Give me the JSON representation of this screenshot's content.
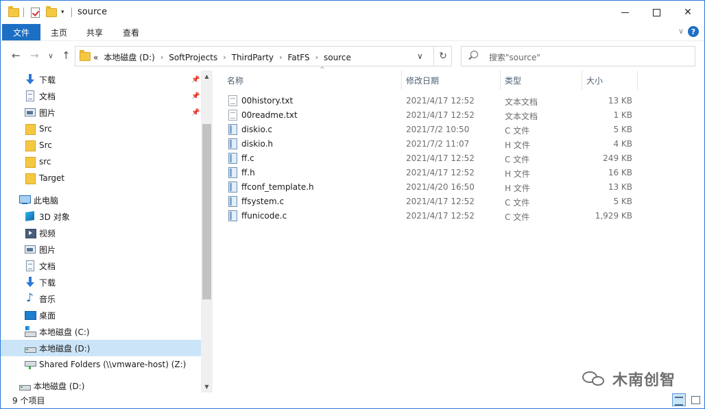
{
  "window": {
    "title": "source",
    "controls": {
      "minimize": "—",
      "maximize": "□",
      "close": "✕"
    }
  },
  "ribbon": {
    "tabs": [
      {
        "label": "文件",
        "active": true
      },
      {
        "label": "主页"
      },
      {
        "label": "共享"
      },
      {
        "label": "查看"
      }
    ],
    "collapse_glyph": "∨",
    "help_glyph": "?"
  },
  "nav": {
    "back": "←",
    "forward": "→",
    "recent": "∨",
    "up": "↑"
  },
  "address": {
    "overflow": "«",
    "crumbs": [
      "本地磁盘 (D:)",
      "SoftProjects",
      "ThirdParty",
      "FatFS",
      "source"
    ],
    "separator": "›",
    "dropdown": "∨",
    "refresh": "↻"
  },
  "search": {
    "placeholder": "搜索\"source\""
  },
  "sidebar": {
    "quick_access": [
      {
        "label": "下载",
        "icon": "download-icon",
        "pinned": true
      },
      {
        "label": "文档",
        "icon": "document-icon",
        "pinned": true
      },
      {
        "label": "图片",
        "icon": "picture-icon",
        "pinned": true
      },
      {
        "label": "Src",
        "icon": "folder-icon"
      },
      {
        "label": "Src",
        "icon": "folder-icon"
      },
      {
        "label": "src",
        "icon": "folder-icon"
      },
      {
        "label": "Target",
        "icon": "folder-icon"
      }
    ],
    "this_pc": {
      "label": "此电脑",
      "items": [
        {
          "label": "3D 对象",
          "icon": "3d-objects-icon"
        },
        {
          "label": "视频",
          "icon": "video-icon"
        },
        {
          "label": "图片",
          "icon": "picture-icon"
        },
        {
          "label": "文档",
          "icon": "document-icon"
        },
        {
          "label": "下载",
          "icon": "download-icon"
        },
        {
          "label": "音乐",
          "icon": "music-icon"
        },
        {
          "label": "桌面",
          "icon": "desktop-icon"
        },
        {
          "label": "本地磁盘 (C:)",
          "icon": "system-drive-icon"
        },
        {
          "label": "本地磁盘 (D:)",
          "icon": "drive-icon",
          "selected": true
        },
        {
          "label": "Shared Folders (\\\\vmware-host) (Z:)",
          "icon": "network-drive-icon"
        }
      ]
    },
    "bottom_item": {
      "label": "本地磁盘 (D:)",
      "icon": "drive-icon"
    },
    "pin_glyph": "📌"
  },
  "columns": {
    "name": "名称",
    "modified": "修改日期",
    "type": "类型",
    "size": "大小",
    "sort_glyph": "^"
  },
  "files": [
    {
      "name": "00history.txt",
      "modified": "2021/4/17 12:52",
      "type": "文本文档",
      "size": "13 KB",
      "kind": "txt"
    },
    {
      "name": "00readme.txt",
      "modified": "2021/4/17 12:52",
      "type": "文本文档",
      "size": "1 KB",
      "kind": "txt"
    },
    {
      "name": "diskio.c",
      "modified": "2021/7/2 10:50",
      "type": "C 文件",
      "size": "5 KB",
      "kind": "code"
    },
    {
      "name": "diskio.h",
      "modified": "2021/7/2 11:07",
      "type": "H 文件",
      "size": "4 KB",
      "kind": "code"
    },
    {
      "name": "ff.c",
      "modified": "2021/4/17 12:52",
      "type": "C 文件",
      "size": "249 KB",
      "kind": "code"
    },
    {
      "name": "ff.h",
      "modified": "2021/4/17 12:52",
      "type": "H 文件",
      "size": "16 KB",
      "kind": "code"
    },
    {
      "name": "ffconf_template.h",
      "modified": "2021/4/20 16:50",
      "type": "H 文件",
      "size": "13 KB",
      "kind": "code"
    },
    {
      "name": "ffsystem.c",
      "modified": "2021/4/17 12:52",
      "type": "C 文件",
      "size": "5 KB",
      "kind": "code"
    },
    {
      "name": "ffunicode.c",
      "modified": "2021/4/17 12:52",
      "type": "C 文件",
      "size": "1,929 KB",
      "kind": "code"
    }
  ],
  "status": {
    "item_count": "9 个项目"
  },
  "watermark": {
    "text": "木南创智"
  },
  "colors": {
    "accent": "#1d6fc4",
    "selected": "#cce4f7",
    "folder": "#f5c842"
  }
}
